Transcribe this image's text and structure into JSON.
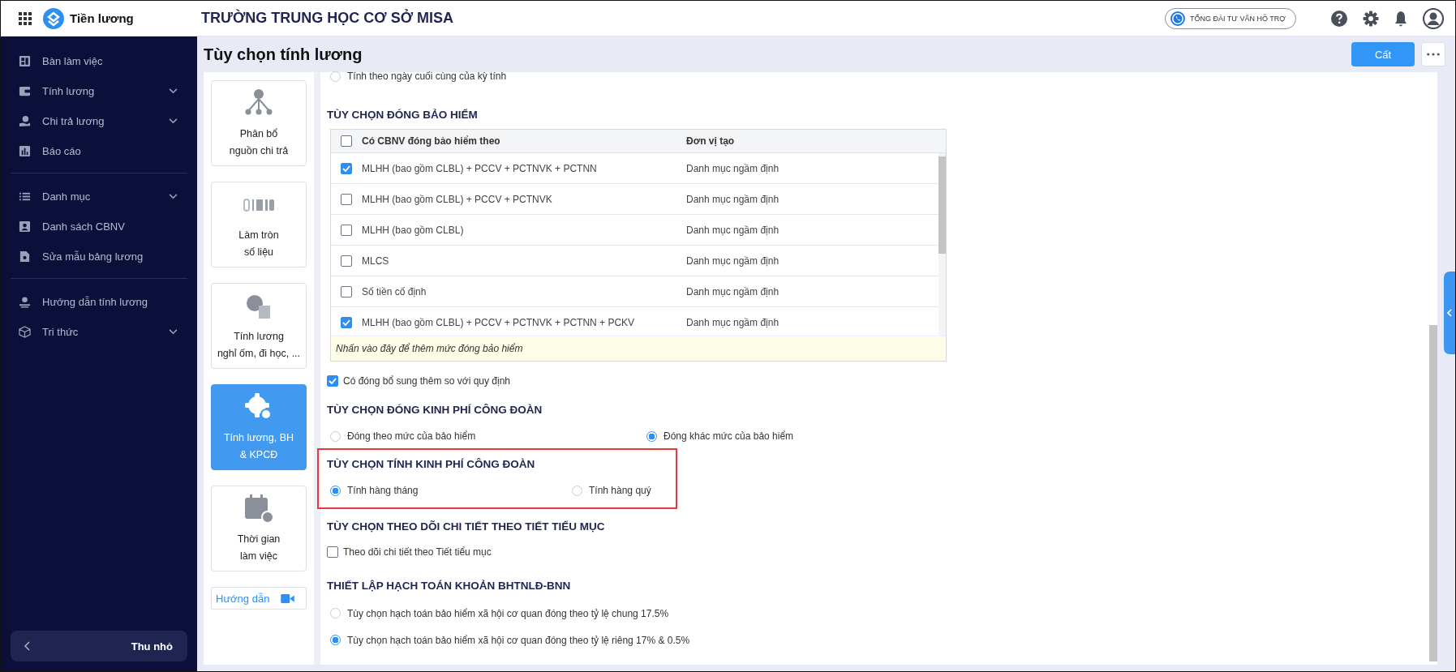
{
  "top_bar": {
    "app_name": "Tiền lương",
    "school": "TRƯỜNG TRUNG HỌC CƠ SỞ MISA",
    "hotline": "TỔNG ĐÀI TƯ VẤN HỖ TRỢ"
  },
  "sidebar": {
    "groups": [
      [
        {
          "label": "Bàn làm việc",
          "has_submenu": false
        },
        {
          "label": "Tính lương",
          "has_submenu": true
        },
        {
          "label": "Chi trả lương",
          "has_submenu": true
        },
        {
          "label": "Báo cáo",
          "has_submenu": false
        }
      ],
      [
        {
          "label": "Danh mục",
          "has_submenu": true
        },
        {
          "label": "Danh sách CBNV",
          "has_submenu": false
        },
        {
          "label": "Sửa mẫu bảng lương",
          "has_submenu": false
        }
      ],
      [
        {
          "label": "Hướng dẫn tính lương",
          "has_submenu": false
        },
        {
          "label": "Tri thức",
          "has_submenu": true
        }
      ]
    ],
    "collapse_label": "Thu nhỏ"
  },
  "page": {
    "title": "Tùy chọn tính lương",
    "save_button": "Cất"
  },
  "option_cards": [
    {
      "lines": [
        "Phân bổ",
        "nguồn chi trả"
      ],
      "selected": false
    },
    {
      "lines": [
        "Làm tròn",
        "số liệu"
      ],
      "selected": false
    },
    {
      "lines": [
        "Tính lương",
        "nghỉ ốm, đi học, ..."
      ],
      "selected": false
    },
    {
      "lines": [
        "Tính lương, BH",
        "& KPCĐ"
      ],
      "selected": true
    },
    {
      "lines": [
        "Thời gian",
        "làm việc"
      ],
      "selected": false
    }
  ],
  "guide_button": "Hướng dẫn",
  "blocks": [
    {
      "kind": "radios",
      "options": [
        {
          "label": "Tính theo ngày cuối cùng của kỳ tính",
          "selected": false
        }
      ]
    },
    {
      "kind": "heading",
      "text": "TÙY CHỌN ĐÓNG BẢO HIỂM"
    },
    {
      "kind": "table",
      "columns": [
        "Có CBNV đóng bảo hiểm theo",
        "Đơn vị tạo"
      ],
      "all_checked": false,
      "rows": [
        {
          "checked": true,
          "name": "MLHH (bao gồm CLBL) + PCCV + PCTNVK + PCTNN",
          "creator": "Danh mục ngầm định"
        },
        {
          "checked": false,
          "name": "MLHH (bao gồm CLBL) + PCCV + PCTNVK",
          "creator": "Danh mục ngầm định"
        },
        {
          "checked": false,
          "name": "MLHH (bao gồm CLBL)",
          "creator": "Danh mục ngầm định"
        },
        {
          "checked": false,
          "name": "MLCS",
          "creator": "Danh mục ngầm định"
        },
        {
          "checked": false,
          "name": "Số tiền cố định",
          "creator": "Danh mục ngầm định"
        },
        {
          "checked": true,
          "name": "MLHH (bao gồm CLBL) + PCCV + PCTNVK + PCTNN + PCKV",
          "creator": "Danh mục ngầm định"
        }
      ],
      "footer": "Nhấn vào đây để thêm mức đóng bảo hiểm"
    },
    {
      "kind": "checkbox",
      "label": "Có đóng bổ sung thêm so với quy định",
      "checked": true
    },
    {
      "kind": "heading",
      "text": "TÙY CHỌN ĐÓNG KINH PHÍ CÔNG ĐOÀN"
    },
    {
      "kind": "radios",
      "options": [
        {
          "label": "Đóng theo mức của bảo hiểm",
          "selected": false
        },
        {
          "label": "Đóng khác mức của bảo hiểm",
          "selected": true
        }
      ]
    },
    {
      "kind": "frame",
      "blocks": [
        {
          "kind": "heading",
          "text": "TÙY CHỌN TÍNH KINH PHÍ CÔNG ĐOÀN"
        },
        {
          "kind": "radios",
          "options": [
            {
              "label": "Tính hàng tháng",
              "selected": true
            },
            {
              "label": "Tính hàng quý",
              "selected": false
            }
          ]
        }
      ]
    },
    {
      "kind": "heading",
      "text": "TÙY CHỌN THEO DÕI CHI TIẾT THEO TIẾT TIỂU MỤC"
    },
    {
      "kind": "checkbox",
      "label": "Theo dõi chi tiết theo Tiết tiểu mục",
      "checked": false
    },
    {
      "kind": "heading",
      "text": "THIẾT LẬP HẠCH TOÁN KHOẢN BHTNLĐ-BNN"
    },
    {
      "kind": "radio_list",
      "options": [
        {
          "label": "Tùy chọn hạch toán bảo hiểm xã hội cơ quan đóng theo tỷ lệ chung 17.5%",
          "selected": false
        },
        {
          "label": "Tùy chọn hạch toán bảo hiểm xã hội cơ quan đóng theo tỷ lệ riêng 17% & 0.5%",
          "selected": true
        }
      ]
    }
  ]
}
